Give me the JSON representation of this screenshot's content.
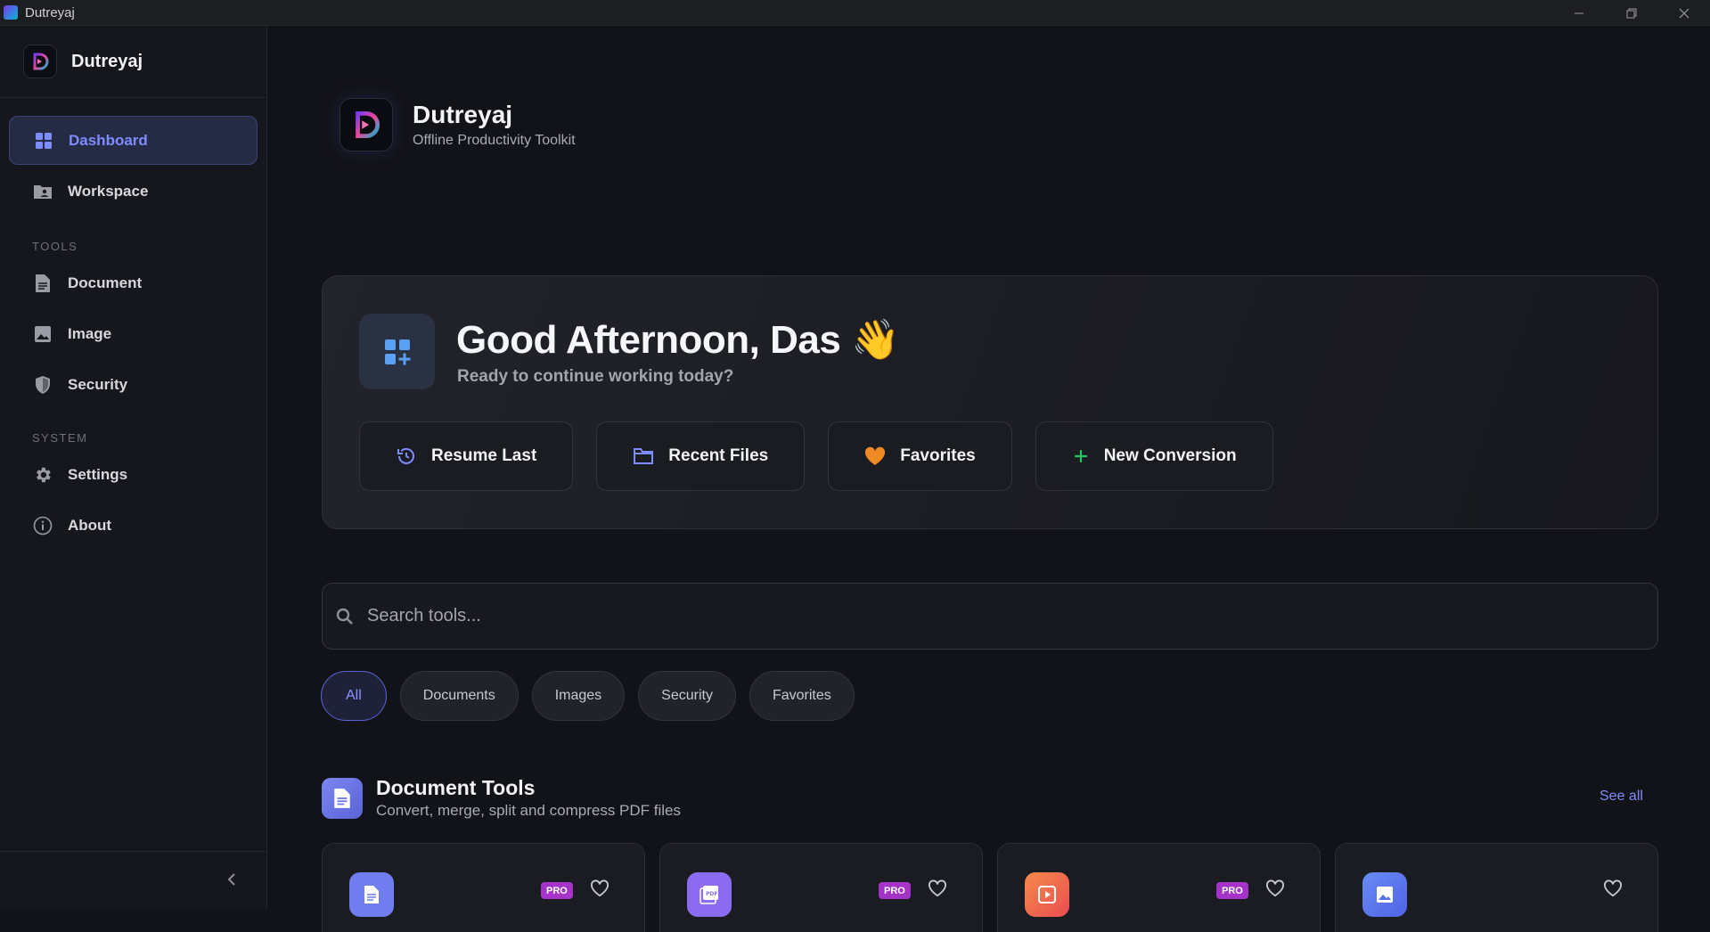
{
  "window": {
    "title": "Dutreyaj",
    "controls": [
      "minimize",
      "restore",
      "close"
    ]
  },
  "sidebar": {
    "brand": "Dutreyaj",
    "items": [
      {
        "label": "Dashboard",
        "icon": "grid-icon",
        "active": true
      },
      {
        "label": "Workspace",
        "icon": "folder-user-icon"
      }
    ],
    "tools_label": "TOOLS",
    "tools": [
      {
        "label": "Document",
        "icon": "document-icon"
      },
      {
        "label": "Image",
        "icon": "image-icon"
      },
      {
        "label": "Security",
        "icon": "shield-icon"
      }
    ],
    "system_label": "SYSTEM",
    "system": [
      {
        "label": "Settings",
        "icon": "gear-icon"
      },
      {
        "label": "About",
        "icon": "info-icon"
      }
    ]
  },
  "header": {
    "title": "Dutreyaj",
    "subtitle": "Offline Productivity Toolkit"
  },
  "welcome": {
    "greeting": "Good Afternoon, Das 👋",
    "subtitle": "Ready to continue working today?",
    "actions": [
      {
        "label": "Resume Last",
        "icon": "history-icon",
        "color": "#7d8cff"
      },
      {
        "label": "Recent Files",
        "icon": "folder-icon",
        "color": "#7d8cff"
      },
      {
        "label": "Favorites",
        "icon": "heart-icon",
        "color": "#f08a24"
      },
      {
        "label": "New Conversion",
        "icon": "plus-icon",
        "color": "#22c55e"
      }
    ]
  },
  "search": {
    "placeholder": "Search tools..."
  },
  "filters": [
    "All",
    "Documents",
    "Images",
    "Security",
    "Favorites"
  ],
  "active_filter": "All",
  "section": {
    "title": "Document Tools",
    "subtitle": "Convert, merge, split and compress PDF files",
    "see_all": "See all"
  },
  "cards": [
    {
      "icon": "document-icon",
      "pro": "PRO",
      "color": "#6f7df0"
    },
    {
      "icon": "pdf-icon",
      "pro": "PRO",
      "color": "#8b6cf0"
    },
    {
      "icon": "play-icon",
      "pro": "PRO",
      "color": "#f06a4a"
    },
    {
      "icon": "image-icon",
      "pro": "",
      "color": "#5b7cf0"
    }
  ],
  "colors": {
    "accent": "#7d8cff",
    "pro_badge": "#a533c9",
    "background": "#121318"
  }
}
